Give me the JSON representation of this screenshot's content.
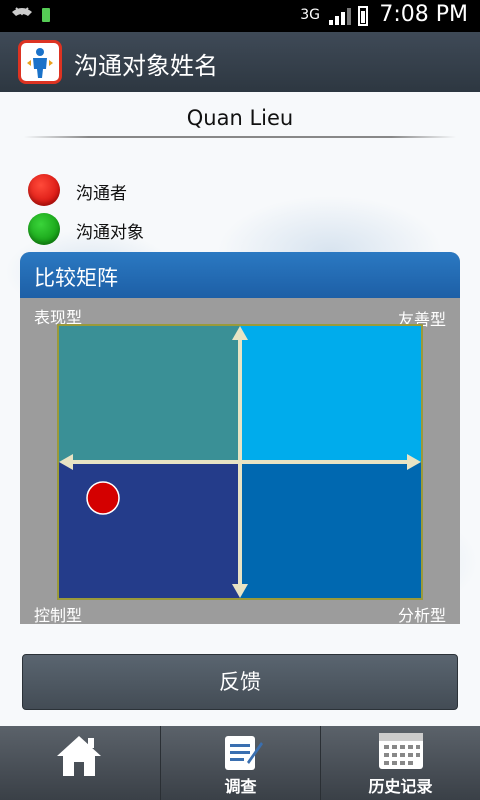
{
  "status_bar": {
    "network": "3G",
    "time": "7:08 PM"
  },
  "app_bar": {
    "title": "沟通对象姓名"
  },
  "contact": {
    "name": "Quan Lieu"
  },
  "legend": [
    {
      "label": "沟通者",
      "color": "#d40000"
    },
    {
      "label": "沟通对象",
      "color": "#0a9a0a"
    }
  ],
  "matrix": {
    "title": "比较矩阵",
    "corners": {
      "top_left": "表现型",
      "top_right": "友善型",
      "bottom_left": "控制型",
      "bottom_right": "分析型"
    },
    "quadrant_colors": {
      "top_left": "#3a9096",
      "top_right": "#00acec",
      "bottom_left": "#243c8a",
      "bottom_right": "#0068b0"
    },
    "axis_color": "#e8e4c4",
    "marker": {
      "who": "沟通者",
      "color": "#d40000"
    }
  },
  "feedback_button": {
    "label": "反馈"
  },
  "bottom_nav": [
    {
      "id": "home",
      "label": "",
      "icon": "home-icon"
    },
    {
      "id": "survey",
      "label": "调查",
      "icon": "survey-icon"
    },
    {
      "id": "history",
      "label": "历史记录",
      "icon": "calendar-icon"
    }
  ]
}
